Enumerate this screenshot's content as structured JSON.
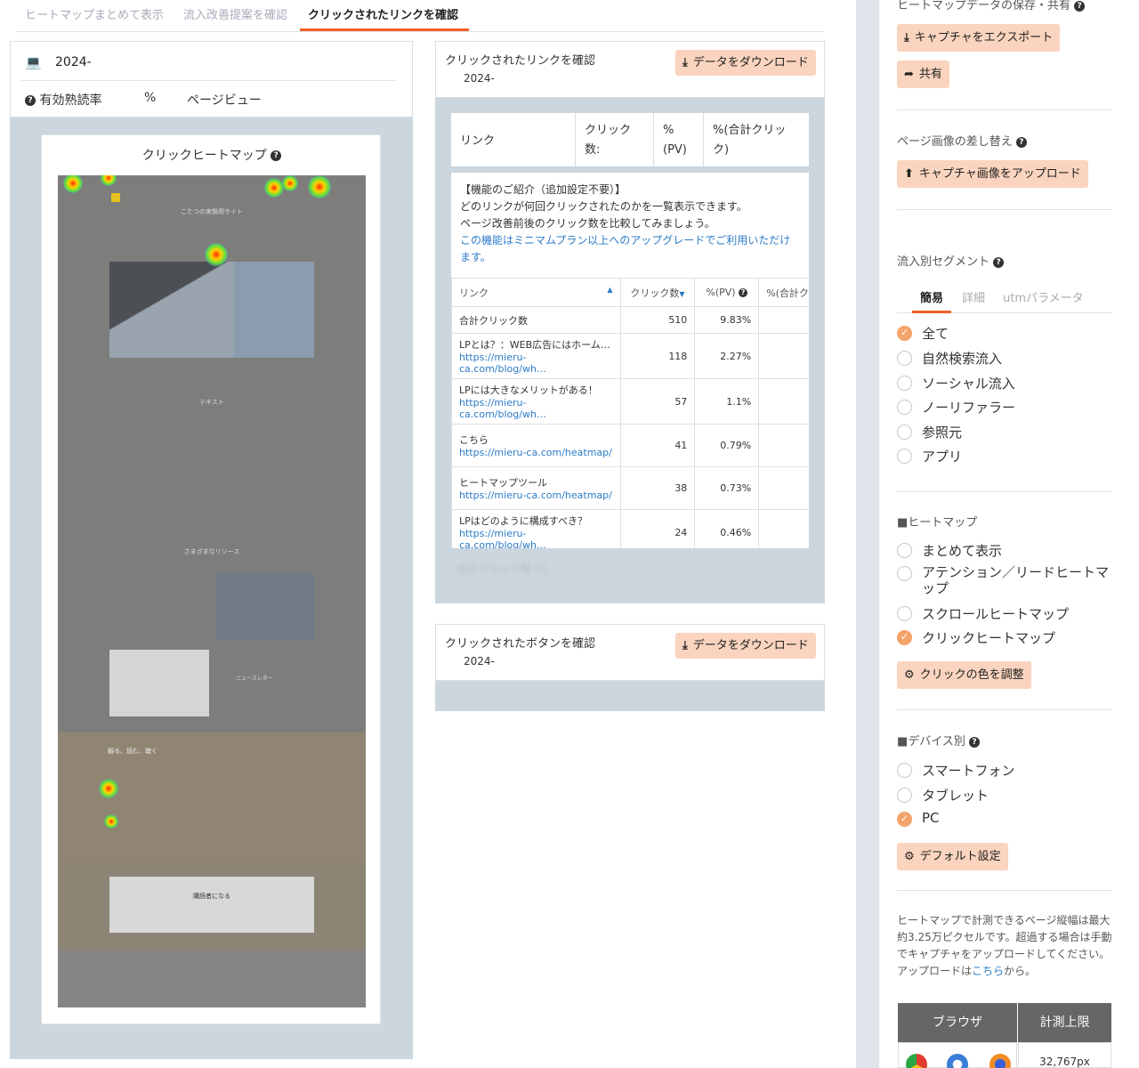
{
  "tabs": [
    {
      "label": "ヒートマップまとめて表示"
    },
    {
      "label": "流入改善提案を確認"
    },
    {
      "label": "クリックされたリンクを確認"
    }
  ],
  "left": {
    "date": "2024-",
    "stats": {
      "read_label": "有効熟読率",
      "percent": "%",
      "pv_label": "ページビュー"
    },
    "heatmap_title": "クリックヒートマップ"
  },
  "preview": {
    "site_title": "こたつの実験用サイト",
    "text_heading": "テキスト",
    "resources_heading": "さまざまなリソース",
    "news_heading": "ニュースレター",
    "watch_heading": "観る、読む、聴く",
    "subscribe_heading": "購読者になる"
  },
  "links_panel": {
    "title": "クリックされたリンクを確認",
    "date": "2024-",
    "download": "データをダウンロード",
    "header": [
      "リンク",
      "クリック数:",
      "% (PV)",
      "%(合計クリック)"
    ],
    "info": [
      "【機能のご紹介（追加設定不要）】",
      "どのリンクが何回クリックされたのかを一覧表示できます。",
      "ページ改善前後のクリック数を比較してみましょう。"
    ],
    "info_link": "この機能はミニマムプラン以上へのアップグレードでご利用いただけます。",
    "cols": [
      "リンク",
      "クリック数",
      "%(PV)",
      "%(合計ク"
    ],
    "rows": [
      {
        "title": "合計クリック数",
        "url": "",
        "clicks": "510",
        "pv": "9.83%"
      },
      {
        "title": "LPとは？：WEB広告にはホーム…",
        "url": "https://mieru-ca.com/blog/wh…",
        "clicks": "118",
        "pv": "2.27%"
      },
      {
        "title": "LPには大きなメリットがある！",
        "url": "https://mieru-ca.com/blog/wh…",
        "clicks": "57",
        "pv": "1.1%"
      },
      {
        "title": "こちら",
        "url": "https://mieru-ca.com/heatmap/",
        "clicks": "41",
        "pv": "0.79%"
      },
      {
        "title": "ヒートマップツール",
        "url": "https://mieru-ca.com/heatmap/",
        "clicks": "38",
        "pv": "0.73%"
      },
      {
        "title": "LPはどのように構成すべき？",
        "url": "https://mieru-ca.com/blog/wh…",
        "clicks": "24",
        "pv": "0.46%"
      }
    ],
    "footer": "合計クリック数 11"
  },
  "buttons_panel": {
    "title": "クリックされたボタンを確認",
    "date": "2024-",
    "download": "データをダウンロード"
  },
  "side": {
    "save_title": "ヒートマップデータの保存・共有",
    "export": "キャプチャをエクスポート",
    "share": "共有",
    "replace_title": "ページ画像の差し替え",
    "upload": "キャプチャ画像をアップロード",
    "segment_title": "流入別セグメント",
    "seg_tabs": [
      "簡易",
      "詳細",
      "utmパラメータ"
    ],
    "segments": [
      "全て",
      "自然検索流入",
      "ソーシャル流入",
      "ノーリファラー",
      "参照元",
      "アプリ"
    ],
    "heatmap_title": "■ヒートマップ",
    "heatmaps": [
      "まとめて表示",
      "アテンション／リードヒートマップ",
      "スクロールヒートマップ",
      "クリックヒートマップ"
    ],
    "color_btn": "クリックの色を調整",
    "device_title": "■デバイス別",
    "devices": [
      "スマートフォン",
      "タブレット",
      "PC"
    ],
    "default_btn": "デフォルト設定",
    "note": "ヒートマップで計測できるページ縦幅は最大約3.25万ピクセルです。超過する場合は手動でキャプチャをアップロードしてください。アップロードは",
    "note_link": "こちら",
    "note_end": "から。",
    "table_headers": [
      "ブラウザ",
      "計測上限"
    ],
    "limit": "32,767px"
  },
  "colors": {
    "accent": "#f0602a",
    "button": "#fad4be",
    "panel_gray": "#cbd6de"
  }
}
